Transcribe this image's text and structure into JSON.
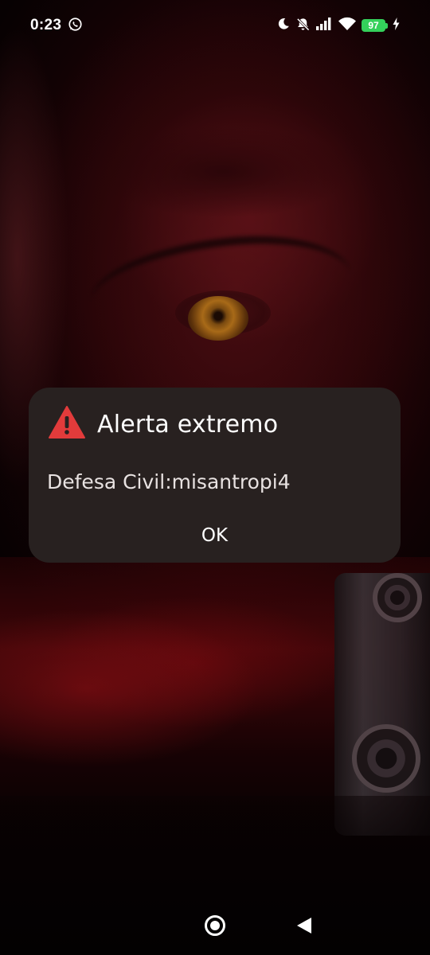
{
  "status_bar": {
    "time": "0:23",
    "battery_level": "97",
    "icons": [
      "whatsapp-icon",
      "moon-icon",
      "bell-off-icon",
      "cellular-signal-icon",
      "wifi-icon",
      "battery-icon",
      "charging-bolt-icon"
    ]
  },
  "alert": {
    "icon": "warning-triangle-icon",
    "icon_color": "#e23b3b",
    "title": "Alerta extremo",
    "message": "Defesa Civil:misantropi4",
    "ok_label": "OK",
    "background_color": "#282120"
  },
  "nav_bar": {
    "buttons": [
      "home-icon",
      "back-icon"
    ]
  },
  "colors": {
    "battery_fill": "#34d15b",
    "wallpaper_tint": "#4a0d12"
  }
}
